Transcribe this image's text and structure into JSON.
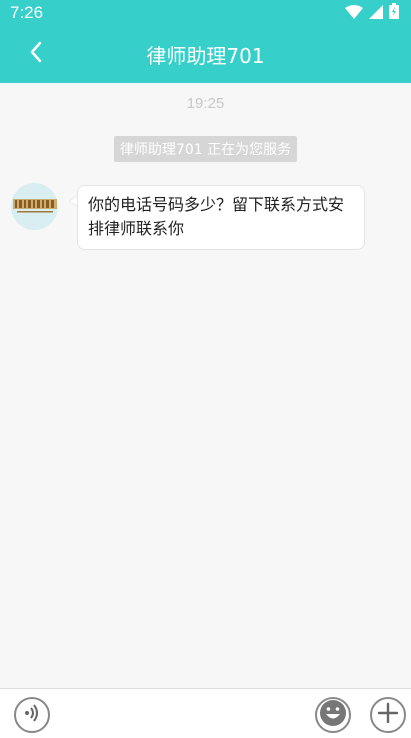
{
  "status_bar": {
    "time": "7:26",
    "icons": [
      "wifi-icon",
      "cellular-icon",
      "battery-icon"
    ]
  },
  "header": {
    "title": "律师助理701",
    "back_icon": "chevron-left-icon",
    "background_color": "#36cfc9"
  },
  "chat": {
    "timestamp": "19:25",
    "system_notice": "律师助理701 正在为您服务",
    "messages": [
      {
        "sender": "律师助理701",
        "avatar_icon": "law-firm-logo-icon",
        "text": "你的电话号码多少？留下联系方式安排律师联系你"
      }
    ]
  },
  "input_bar": {
    "voice_icon": "voice-icon",
    "emoji_icon": "emoji-icon",
    "plus_icon": "plus-icon"
  }
}
